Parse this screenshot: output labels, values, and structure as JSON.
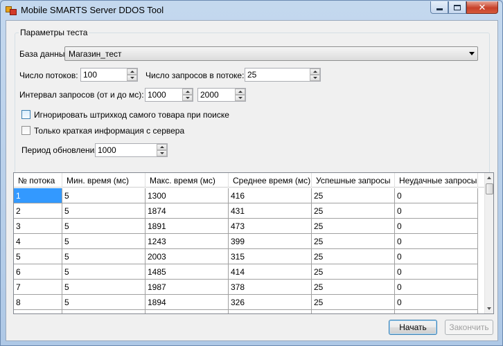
{
  "window": {
    "title": "Mobile SMARTS Server DDOS Tool"
  },
  "group": {
    "legend": "Параметры теста"
  },
  "database": {
    "label": "База данных:",
    "value": "Магазин_тест"
  },
  "threads": {
    "label": "Число потоков:",
    "value": "100"
  },
  "requests_per_thread": {
    "label": "Число запросов в потоке:",
    "value": "25"
  },
  "interval": {
    "label": "Интервал запросов (от и до мс):",
    "from": "1000",
    "to": "2000"
  },
  "options": {
    "ignore_barcode": {
      "label": "Игнорировать штрихкод самого товара при поиске",
      "checked": false
    },
    "short_info": {
      "label": "Только краткая информация с сервера",
      "checked": false
    }
  },
  "refresh": {
    "label": "Период обновления:",
    "value": "1000"
  },
  "table": {
    "columns": [
      "№ потока",
      "Мин. время (мс)",
      "Макс. время  (мс)",
      "Среднее время  (мс)",
      "Успешные запросы",
      "Неудачные запросы"
    ],
    "rows": [
      [
        "1",
        "5",
        "1300",
        "416",
        "25",
        "0"
      ],
      [
        "2",
        "5",
        "1874",
        "431",
        "25",
        "0"
      ],
      [
        "3",
        "5",
        "1891",
        "473",
        "25",
        "0"
      ],
      [
        "4",
        "5",
        "1243",
        "399",
        "25",
        "0"
      ],
      [
        "5",
        "5",
        "2003",
        "315",
        "25",
        "0"
      ],
      [
        "6",
        "5",
        "1485",
        "414",
        "25",
        "0"
      ],
      [
        "7",
        "5",
        "1987",
        "378",
        "25",
        "0"
      ],
      [
        "8",
        "5",
        "1894",
        "326",
        "25",
        "0"
      ]
    ]
  },
  "buttons": {
    "start": "Начать",
    "finish": "Закончить"
  }
}
